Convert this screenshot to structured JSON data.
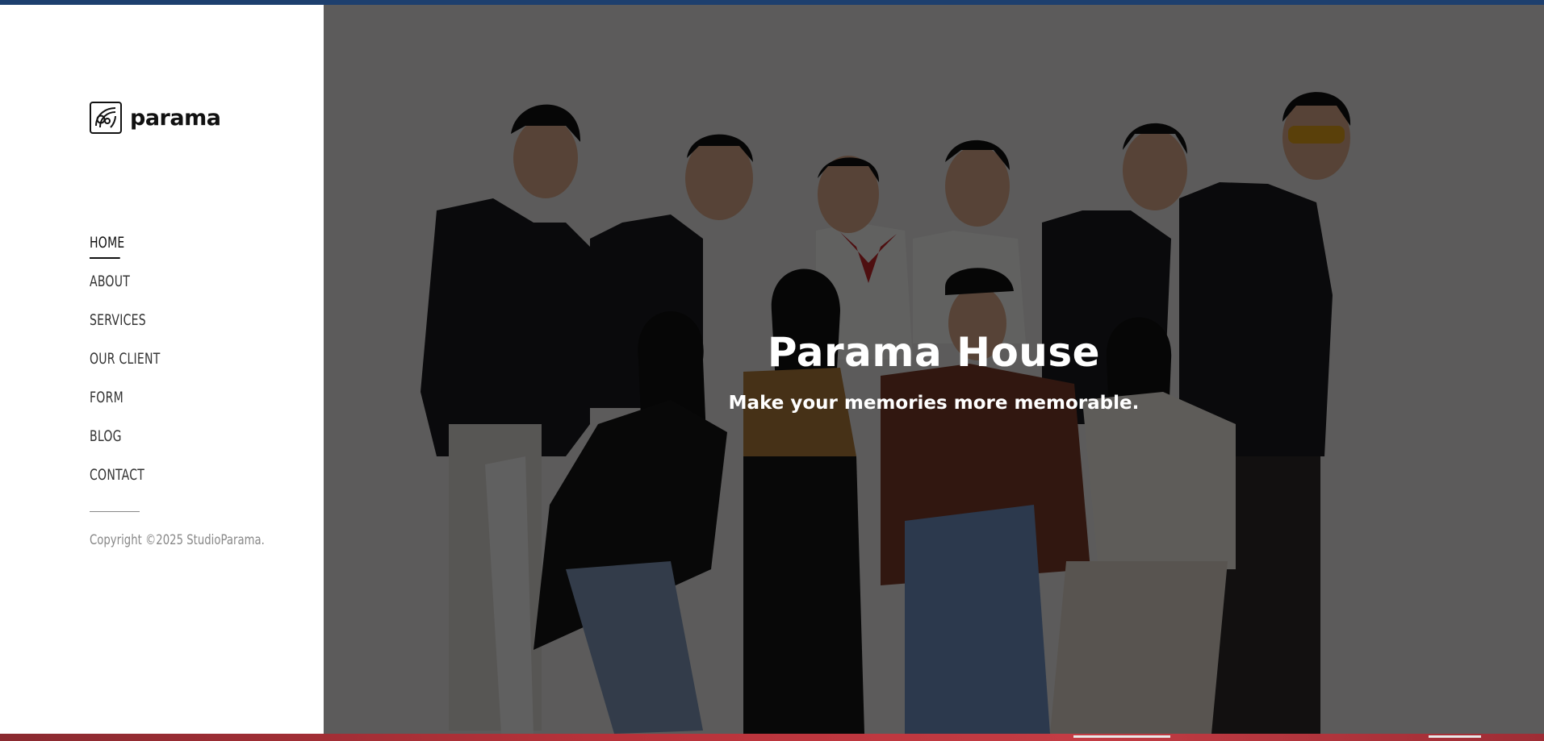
{
  "brand": {
    "name": "parama",
    "logo_icon": "parama-logo-icon"
  },
  "nav": {
    "items": [
      {
        "label": "HOME",
        "active": true
      },
      {
        "label": "ABOUT",
        "active": false
      },
      {
        "label": "SERVICES",
        "active": false
      },
      {
        "label": "OUR CLIENT",
        "active": false
      },
      {
        "label": "FORM",
        "active": false
      },
      {
        "label": "BLOG",
        "active": false
      },
      {
        "label": "CONTACT",
        "active": false
      }
    ]
  },
  "footer": {
    "copyright": "Copyright ©2025 StudioParama."
  },
  "hero": {
    "title": "Parama House",
    "subtitle": "Make your memories more memorable.",
    "image": "group-team-photo"
  },
  "colors": {
    "top_strip": "#1d3f6e",
    "bottom_strip": "#b8323a",
    "sidebar_bg": "#ffffff",
    "hero_overlay": "rgba(0,0,0,0.6)"
  }
}
